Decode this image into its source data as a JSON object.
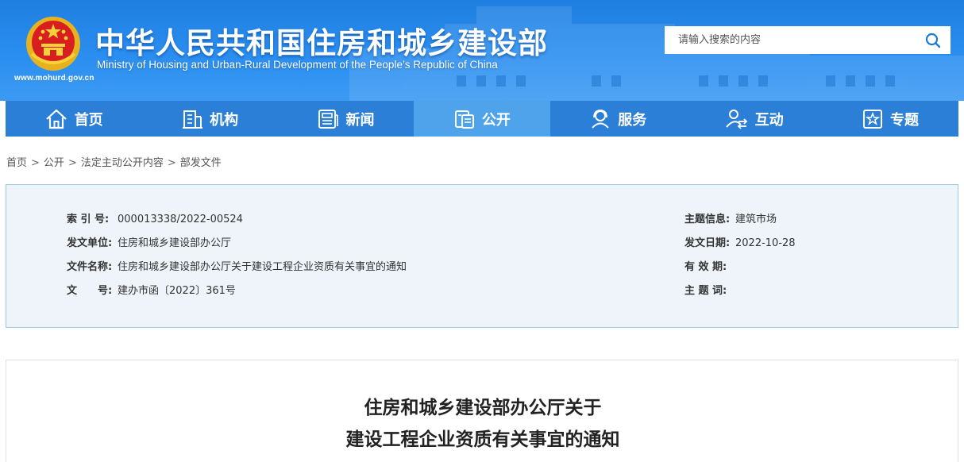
{
  "header": {
    "title_cn": "中华人民共和国住房和城乡建设部",
    "title_en": "Ministry of Housing and Urban-Rural Development of the People’s Republic of China",
    "site_url": "www.mohurd.gov.cn",
    "emblem_icon": "national-emblem-icon",
    "search": {
      "placeholder": "请输入搜索的内容",
      "value": "",
      "icon": "search-icon"
    }
  },
  "nav": {
    "items": [
      {
        "label": "首页",
        "icon": "home-icon"
      },
      {
        "label": "机构",
        "icon": "building-icon"
      },
      {
        "label": "新闻",
        "icon": "newspaper-icon"
      },
      {
        "label": "公开",
        "icon": "document-icon",
        "active": true
      },
      {
        "label": "服务",
        "icon": "service-icon"
      },
      {
        "label": "互动",
        "icon": "interact-icon"
      },
      {
        "label": "专题",
        "icon": "star-icon"
      }
    ]
  },
  "breadcrumb": [
    "首页",
    "公开",
    "法定主动公开内容",
    "部发文件"
  ],
  "info": {
    "index_no": {
      "label": "索 引 号:",
      "value": "000013338/2022-00524"
    },
    "issuer": {
      "label": "发文单位:",
      "value": "住房和城乡建设部办公厅"
    },
    "doc_name": {
      "label": "文件名称:",
      "value": "住房和城乡建设部办公厅关于建设工程企业资质有关事宜的通知"
    },
    "doc_no": {
      "label": "文　　号:",
      "value": "建办市函〔2022〕361号"
    },
    "topic": {
      "label": "主题信息:",
      "value": "建筑市场"
    },
    "date": {
      "label": "发文日期:",
      "value": "2022-10-28"
    },
    "validity": {
      "label": "有 效 期:",
      "value": ""
    },
    "keywords": {
      "label": "主 题 词:",
      "value": ""
    }
  },
  "article": {
    "title_line1": "住房和城乡建设部办公厅关于",
    "title_line2": "建设工程企业资质有关事宜的通知"
  },
  "colors": {
    "header_blue": "#2a8ef0",
    "nav_blue": "#2b7fd7",
    "nav_active": "#4ea3ea",
    "panel_bg": "#eef4fa"
  }
}
